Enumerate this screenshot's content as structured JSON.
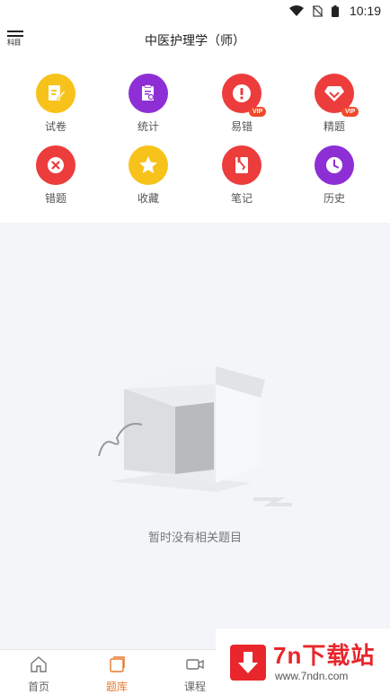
{
  "status_bar": {
    "time": "10:19"
  },
  "header": {
    "subject_label": "科目",
    "title": "中医护理学（师）"
  },
  "grid": [
    {
      "label": "试卷",
      "color": "#f7c21a",
      "icon": "paper-edit-icon",
      "vip": ""
    },
    {
      "label": "统计",
      "color": "#8e2fd6",
      "icon": "report-icon",
      "vip": ""
    },
    {
      "label": "易错",
      "color": "#ec3c3c",
      "icon": "exclamation-icon",
      "vip": "VIP"
    },
    {
      "label": "精题",
      "color": "#ec3c3c",
      "icon": "diamond-icon",
      "vip": "VIP"
    },
    {
      "label": "错题",
      "color": "#ec3c3c",
      "icon": "close-circle-icon",
      "vip": ""
    },
    {
      "label": "收藏",
      "color": "#f7c21a",
      "icon": "star-icon",
      "vip": ""
    },
    {
      "label": "笔记",
      "color": "#ec3c3c",
      "icon": "note-icon",
      "vip": ""
    },
    {
      "label": "历史",
      "color": "#8e2fd6",
      "icon": "clock-icon",
      "vip": ""
    }
  ],
  "empty": {
    "message": "暂时没有相关题目"
  },
  "bottom_nav": [
    {
      "label": "首页",
      "icon": "home-icon",
      "active": false
    },
    {
      "label": "题库",
      "icon": "question-bank-icon",
      "active": true
    },
    {
      "label": "课程",
      "icon": "video-camera-icon",
      "active": false
    }
  ],
  "watermark": {
    "title": "7n下载站",
    "url": "www.7ndn.com"
  },
  "colors": {
    "accent": "#e8782a",
    "background": "#f3f5f8"
  }
}
